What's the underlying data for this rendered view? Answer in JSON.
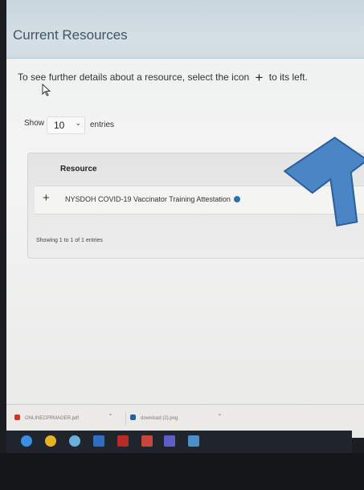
{
  "header": {
    "title": "Current Resources"
  },
  "instructions": {
    "before": "To see further details about a resource, select the icon",
    "icon": "+",
    "after": "to its left."
  },
  "entries_control": {
    "show_label": "Show",
    "selected_value": "10",
    "entries_label": "entries"
  },
  "table": {
    "columns": [
      "Resource"
    ],
    "rows": [
      {
        "expand_icon": "+",
        "resource": "NYSDOH COVID-19 Vaccinator Training Attestation"
      }
    ],
    "footer": "Showing 1 to 1 of 1 entries"
  },
  "downloads": [
    {
      "name": "ONLINECPRMAGER.pdf",
      "icon": "pdf-icon",
      "color": "#c0392b"
    },
    {
      "name": "download (2).png",
      "icon": "image-icon",
      "color": "#2d5f9a"
    }
  ],
  "annotation": {
    "arrow_color": "#4a86c5"
  },
  "taskbar": {
    "icons": [
      "edge-icon",
      "chrome-icon",
      "app-icon",
      "outlook-icon",
      "acrobat-icon",
      "app-icon",
      "teams-icon",
      "folder-icon"
    ]
  }
}
